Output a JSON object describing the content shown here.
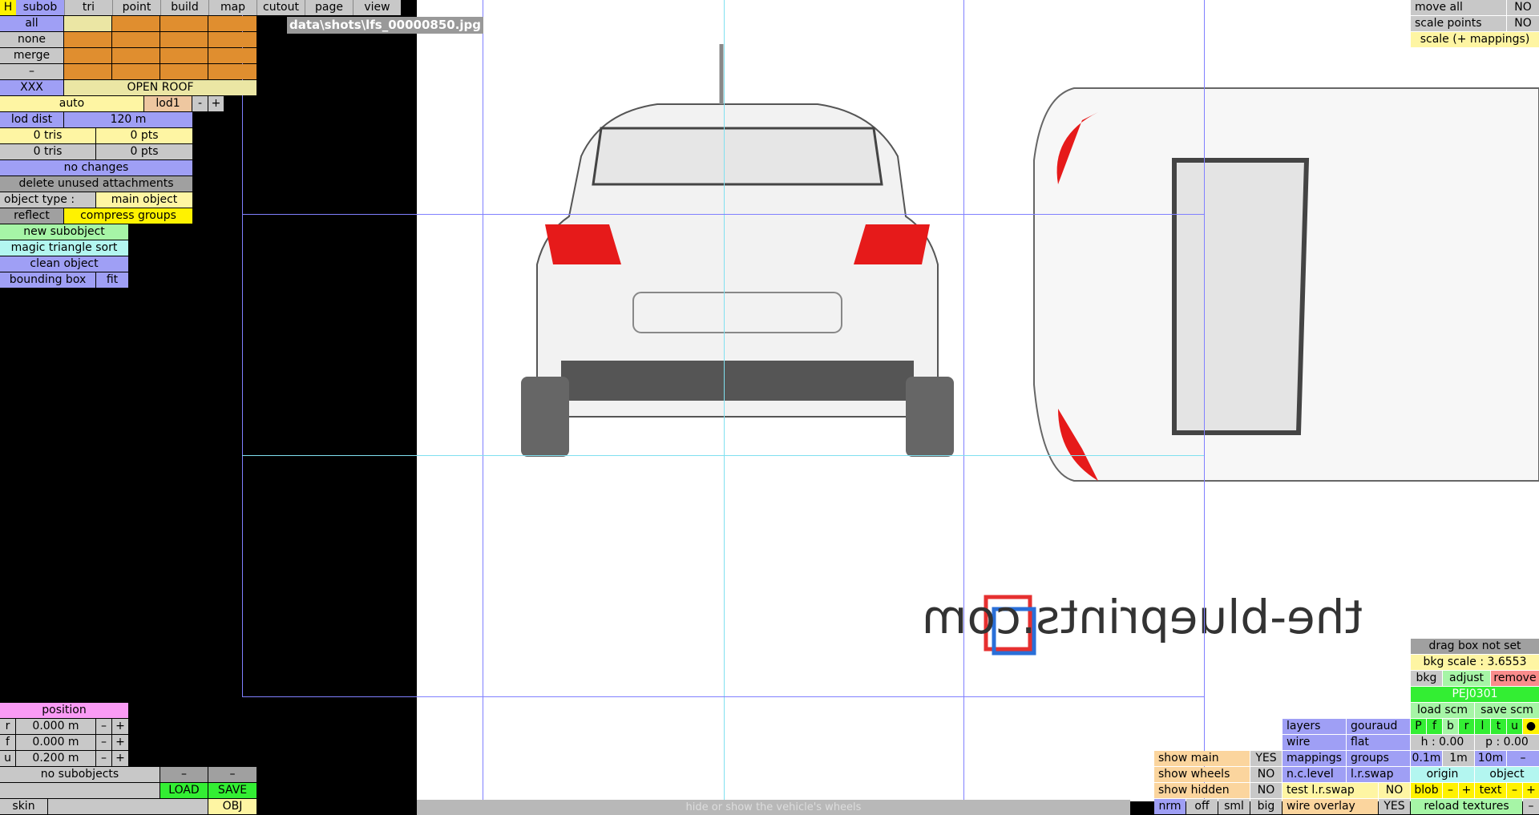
{
  "top_menu": {
    "h": "H",
    "items": [
      "subob",
      "tri",
      "point",
      "build",
      "map",
      "cutout",
      "page",
      "view"
    ]
  },
  "file_path": "data\\shots\\lfs_00000850.jpg",
  "selection": {
    "all": "all",
    "none": "none",
    "merge": "merge",
    "minus": "–"
  },
  "xxx": "XXX",
  "open_roof": "OPEN ROOF",
  "lod": {
    "auto": "auto",
    "lod1": "lod1",
    "minus": "-",
    "plus": "+",
    "dist_label": "lod dist",
    "dist_value": "120 m"
  },
  "stats": {
    "tris1": "0 tris",
    "pts1": "0 pts",
    "tris2": "0 tris",
    "pts2": "0 pts"
  },
  "no_changes": "no changes",
  "delete_unused": "delete unused attachments",
  "object_type": {
    "label": "object type :",
    "value": "main object"
  },
  "reflect": "reflect",
  "compress_groups": "compress groups",
  "new_subobject": "new subobject",
  "magic_sort": "magic triangle sort",
  "clean_object": "clean object",
  "bounding_box": "bounding box",
  "fit": "fit",
  "position": {
    "title": "position",
    "rows": [
      {
        "axis": "r",
        "value": "0.000 m"
      },
      {
        "axis": "f",
        "value": "0.000 m"
      },
      {
        "axis": "u",
        "value": "0.200 m"
      }
    ],
    "minus": "–",
    "plus": "+"
  },
  "subobjects": {
    "label": "no subobjects",
    "minus1": "–",
    "minus2": "–",
    "load": "LOAD",
    "save": "SAVE",
    "skin": "skin",
    "obj": "OBJ"
  },
  "top_right": {
    "move_all": "move all",
    "move_all_val": "NO",
    "scale_points": "scale points",
    "scale_points_val": "NO",
    "scale_mappings": "scale (+ mappings)"
  },
  "bkg_panel": {
    "drag_box": "drag box not set",
    "bkg_scale": "bkg scale : 3.6553",
    "bkg": "bkg",
    "adjust": "adjust",
    "remove": "remove",
    "code": "PEJ0301",
    "load_scm": "load scm",
    "save_scm": "save scm",
    "views": [
      "P",
      "f",
      "b",
      "r",
      "l",
      "t",
      "u",
      "●"
    ],
    "h": "h : 0.00",
    "p": "p : 0.00",
    "grid": [
      "0.1m",
      "1m",
      "10m",
      "–"
    ],
    "origin": "origin",
    "object": "object",
    "blob": "blob",
    "text": "text",
    "pm": [
      "–",
      "+"
    ],
    "reload": "reload textures",
    "reload_minus": "–"
  },
  "display": {
    "layers": "layers",
    "gouraud": "gouraud",
    "wire": "wire",
    "flat": "flat",
    "mappings": "mappings",
    "groups": "groups",
    "nc_level": "n.c.level",
    "lr_swap": "l.r.swap",
    "test_lr": "test l.r.swap",
    "test_lr_val": "NO",
    "wire_overlay": "wire overlay",
    "wire_overlay_val": "YES"
  },
  "show": {
    "main": "show main",
    "main_val": "YES",
    "wheels": "show wheels",
    "wheels_val": "NO",
    "hidden": "show hidden",
    "hidden_val": "NO",
    "sizes": [
      "nrm",
      "off",
      "sml",
      "big"
    ]
  },
  "status_text": "hide or show the vehicle's wheels",
  "watermark": "the-blueprints.com"
}
